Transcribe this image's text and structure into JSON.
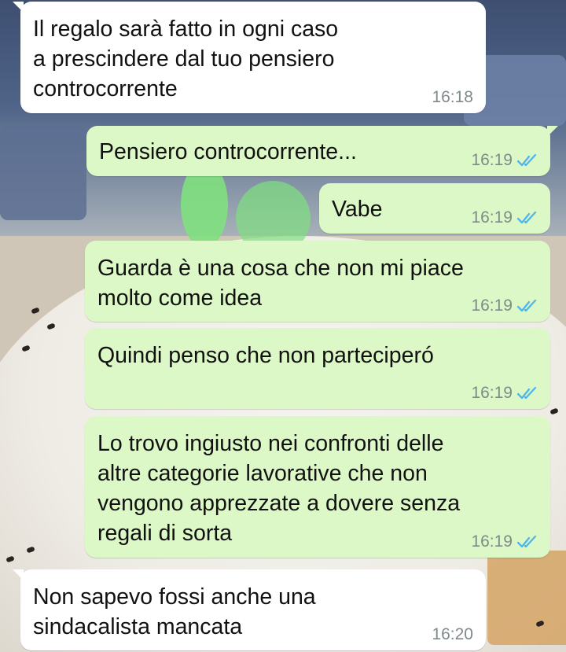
{
  "messages": [
    {
      "direction": "incoming",
      "text": "Il regalo sarà fatto in ogni caso\na prescindere dal tuo pensiero\ncontrocorrente",
      "time": "16:18"
    },
    {
      "direction": "outgoing",
      "text": "Pensiero controcorrente...",
      "time": "16:19",
      "status": "read"
    },
    {
      "direction": "outgoing",
      "text": "Vabe",
      "time": "16:19",
      "status": "read"
    },
    {
      "direction": "outgoing",
      "text": "Guarda è una cosa che non mi piace\nmolto come idea",
      "time": "16:19",
      "status": "read"
    },
    {
      "direction": "outgoing",
      "text": "Quindi penso che non parteciperó",
      "time": "16:19",
      "status": "read"
    },
    {
      "direction": "outgoing",
      "text": "Lo trovo ingiusto nei confronti delle\naltre categorie lavorative che non\nvengono apprezzate a dovere senza\nregali di sorta",
      "time": "16:19",
      "status": "read"
    },
    {
      "direction": "incoming",
      "text": "Non sapevo fossi anche una\nsindacalista mancata",
      "time": "16:20"
    }
  ],
  "colors": {
    "incoming_bubble": "#ffffff",
    "outgoing_bubble": "#dcf8c6",
    "read_tick": "#4fb6ec",
    "timestamp": "#7f8a8b"
  },
  "icons": {
    "read_status": "double-check-icon"
  }
}
